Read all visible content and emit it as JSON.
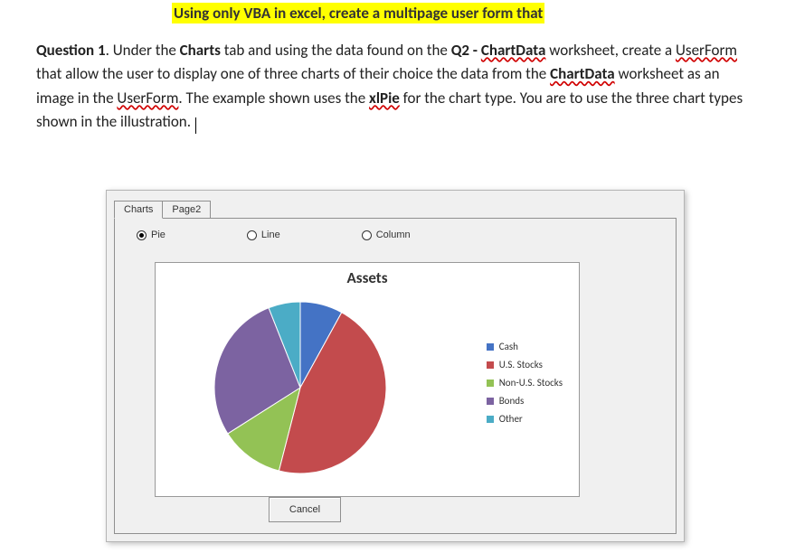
{
  "heading": "Using only VBA in excel, create a multipage user form that",
  "question": {
    "label": "Question 1",
    "t1": ".   Under the ",
    "charts": "Charts",
    "t2": " tab and using the data found on the ",
    "q2": "Q2 - ",
    "chartdata1": "ChartData",
    "t3": " worksheet, create a ",
    "userform1": "UserForm",
    "t4": " that allow the user to display one of three charts of their choice the data from the ",
    "chartdata2": "ChartData",
    "t5": " worksheet as an image in the ",
    "userform2": "UserForm",
    "t6": ".  The example shown uses the ",
    "xlpie": "xlPie",
    "t7": " for the chart type.    You are to use the three chart types shown in the illustration.  "
  },
  "form": {
    "tabs": [
      "Charts",
      "Page2"
    ],
    "active_tab": 0,
    "radios": [
      {
        "label": "Pie",
        "checked": true
      },
      {
        "label": "Line",
        "checked": false
      },
      {
        "label": "Column",
        "checked": false
      }
    ],
    "cancel": "Cancel"
  },
  "chart_data": {
    "type": "pie",
    "title": "Assets",
    "series": [
      {
        "name": "Cash",
        "value": 8,
        "color": "#4473c5"
      },
      {
        "name": "U.S. Stocks",
        "value": 46,
        "color": "#c34b4d"
      },
      {
        "name": "Non-U.S. Stocks",
        "value": 12,
        "color": "#93c255"
      },
      {
        "name": "Bonds",
        "value": 28,
        "color": "#7c63a1"
      },
      {
        "name": "Other",
        "value": 6,
        "color": "#4bacc6"
      }
    ]
  }
}
